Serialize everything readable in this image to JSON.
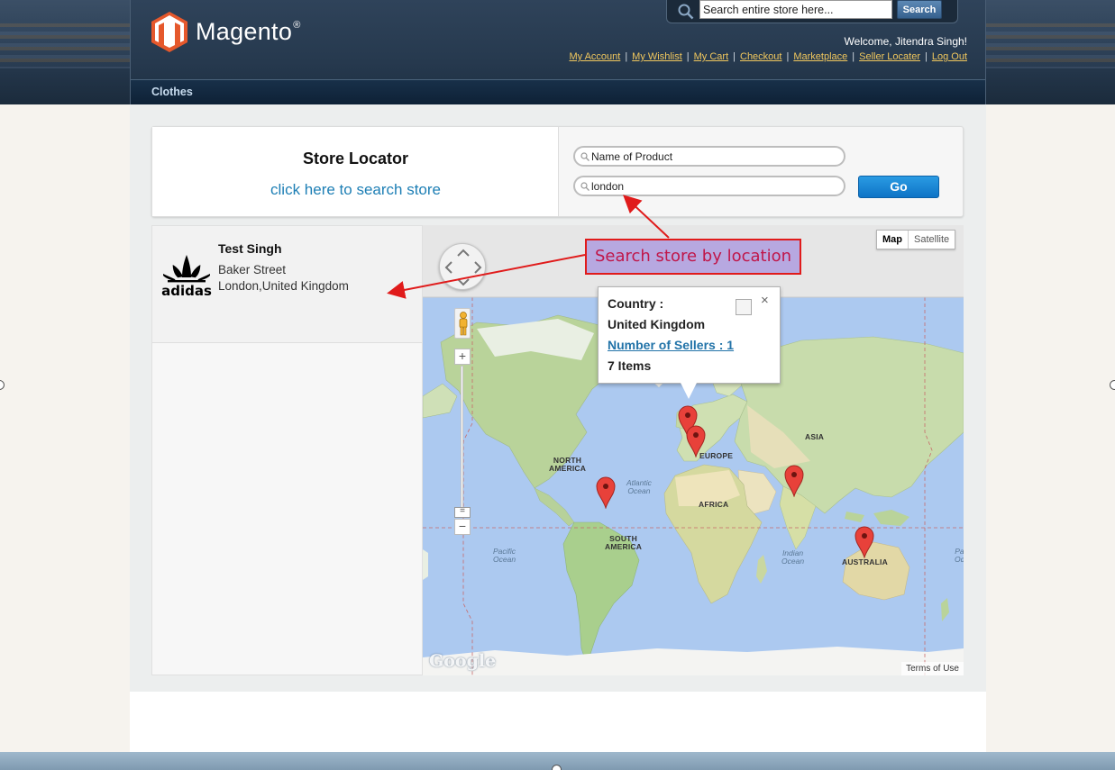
{
  "header": {
    "logo_text": "Magento",
    "logo_reg": "®",
    "search_placeholder": "Search entire store here...",
    "search_button": "Search",
    "welcome": "Welcome, Jitendra Singh!",
    "links": [
      "My Account",
      "My Wishlist",
      "My Cart",
      "Checkout",
      "Marketplace",
      "Seller Locater",
      "Log Out"
    ],
    "separator": "|",
    "nav": {
      "clothes": "Clothes"
    }
  },
  "locator": {
    "title": "Store Locator",
    "search_link": "click here to search store",
    "product_placeholder": "Name of Product",
    "location_value": "london",
    "go_button": "Go"
  },
  "result": {
    "seller_name": "Test Singh",
    "street": "Baker Street",
    "city": "London,United Kingdom",
    "logo_text": "adidas"
  },
  "map": {
    "type_map": "Map",
    "type_satellite": "Satellite",
    "zoom_in": "+",
    "zoom_out": "−",
    "google": "Google",
    "terms": "Terms of Use",
    "labels": {
      "north_america": [
        "NORTH",
        "AMERICA"
      ],
      "south_america": [
        "SOUTH",
        "AMERICA"
      ],
      "europe": "EUROPE",
      "asia": "ASIA",
      "africa": "AFRICA",
      "australia": "AUSTRALIA",
      "atlantic": [
        "Atlantic",
        "Ocean"
      ],
      "pacific": [
        "Pacific",
        "Ocean"
      ],
      "indian": [
        "Indian",
        "Ocean"
      ],
      "pacific_right": [
        "Pa",
        "Oc"
      ]
    },
    "info_window": {
      "country_label": "Country :",
      "country": "United Kingdom",
      "sellers": "Number of Sellers : 1",
      "items": "7 Items",
      "close": "×"
    }
  },
  "annotation": {
    "callout": "Search store by location"
  },
  "colors": {
    "accent_blue": "#1e7fb5",
    "go_blue": "#1584d4",
    "callout_red": "#e01b1b",
    "marker_red": "#e8413a",
    "link_gold": "#f0c75e"
  }
}
